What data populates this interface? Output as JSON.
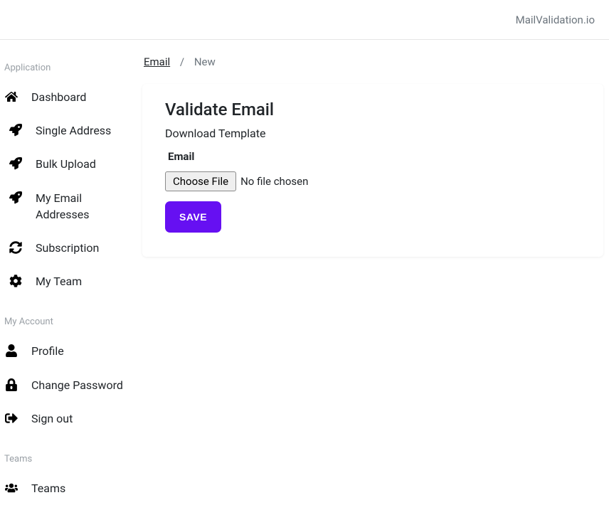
{
  "header": {
    "brand": "MailValidation.io"
  },
  "sidebar": {
    "groups": [
      {
        "label": "Application",
        "items": [
          {
            "label": "Dashboard"
          },
          {
            "label": "Single Address"
          },
          {
            "label": "Bulk Upload"
          },
          {
            "label": "My Email Addresses"
          },
          {
            "label": "Subscription"
          },
          {
            "label": "My Team"
          }
        ]
      },
      {
        "label": "My Account",
        "items": [
          {
            "label": "Profile"
          },
          {
            "label": "Change Password"
          },
          {
            "label": "Sign out"
          }
        ]
      },
      {
        "label": "Teams",
        "items": [
          {
            "label": "Teams"
          }
        ]
      }
    ]
  },
  "breadcrumb": {
    "link": "Email",
    "current": "New"
  },
  "card": {
    "title": "Validate Email",
    "download_label": "Download Template",
    "field_label": "Email",
    "choose_file_label": "Choose File",
    "file_status": "No file chosen",
    "save_label": "SAVE"
  }
}
